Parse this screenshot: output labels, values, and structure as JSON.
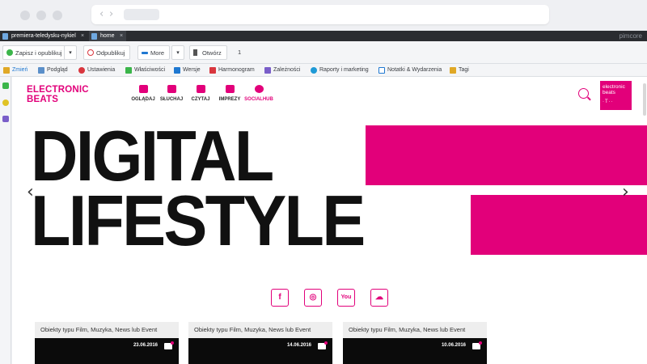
{
  "browser": {
    "nav_back": "‹",
    "nav_forward": "›"
  },
  "tabs": [
    {
      "label": "premiera-teledysku-nykiel",
      "close": "×"
    },
    {
      "label": "home",
      "close": "×"
    }
  ],
  "brand": "pimcore",
  "toolbar": {
    "save_publish": "Zapisz i opublikuj",
    "caret": "▾",
    "unpublish": "Odpublikuj",
    "more": "More",
    "open": "Otwórz",
    "count": "1"
  },
  "secondary": {
    "items": [
      "Zmień",
      "Podgląd",
      "Ustawienia",
      "Właściwości",
      "Wersje",
      "Harmonogram",
      "Zależności",
      "Raporty i marketing",
      "Notatki & Wydarzenia",
      "Tagi"
    ]
  },
  "site": {
    "logo_line1": "ELECTRONIC",
    "logo_line2": "BEATS",
    "nav": [
      "OGLĄDAJ",
      "SŁUCHAJ",
      "CZYTAJ",
      "IMPREZY",
      "SOCIALHUB"
    ],
    "badge_line1": "electronic",
    "badge_line2": "beats",
    "badge_mark": "·T··",
    "hero_line1": "DIGITAL",
    "hero_line2": "LIFESTYLE",
    "arrow_left": "‹",
    "arrow_right": "›",
    "social": [
      "f",
      "◎",
      "You",
      "☁"
    ],
    "cards": [
      {
        "title": "Obiekty typu Film, Muzyka, News lub Event",
        "date": "23.06.2016"
      },
      {
        "title": "Obiekty typu Film, Muzyka, News lub Event",
        "date": "14.06.2016"
      },
      {
        "title": "Obiekty typu Film, Muzyka, News lub Event",
        "date": "10.06.2016"
      }
    ]
  },
  "colors": {
    "accent": "#e2007a",
    "tabbar": "#2a2c30",
    "active_tab_text": "#1f78d1"
  }
}
